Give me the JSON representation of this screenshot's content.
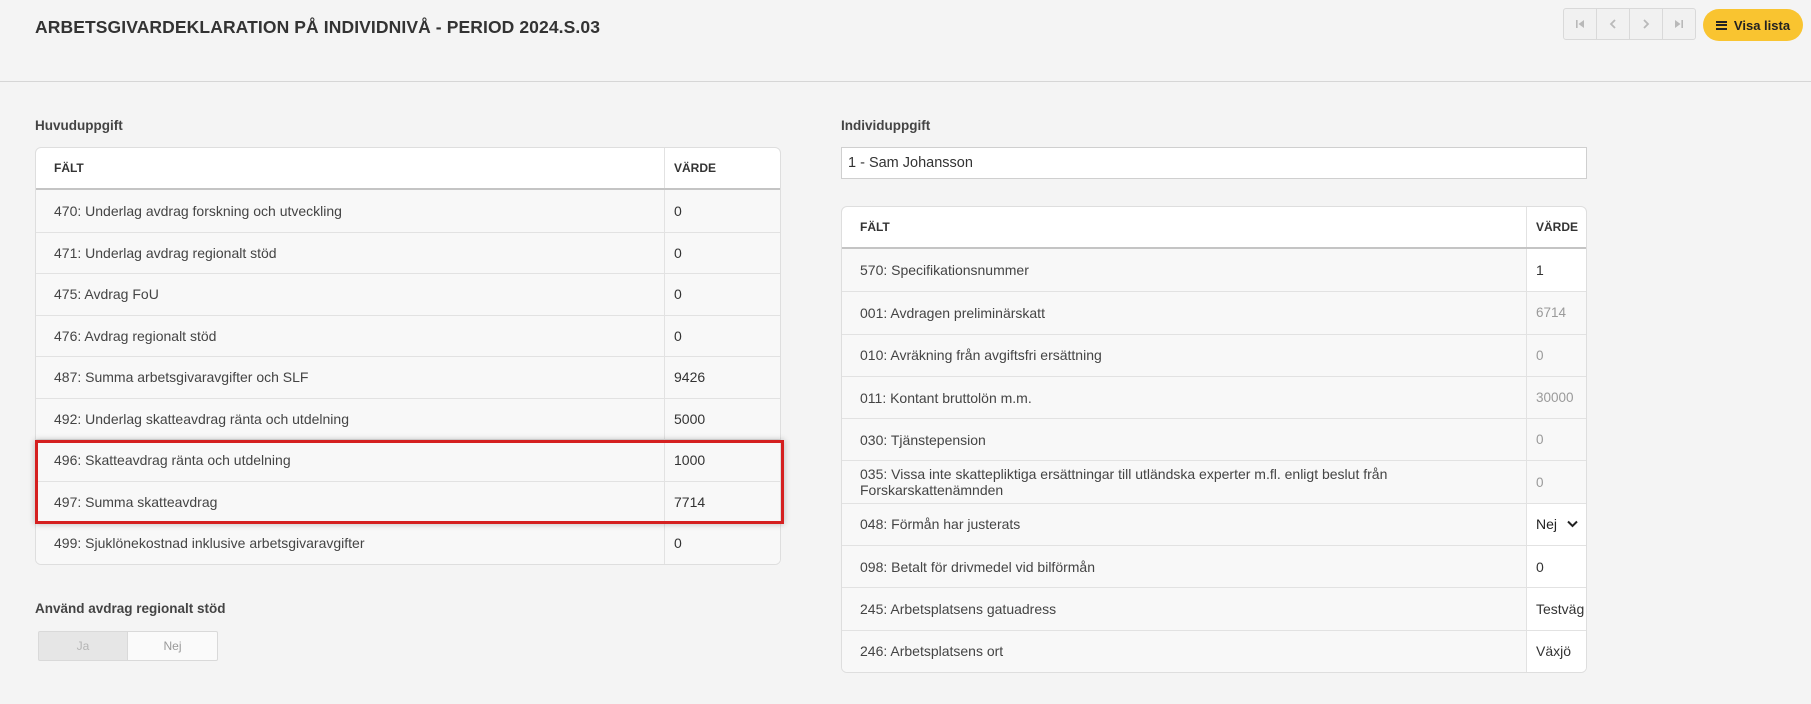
{
  "header": {
    "title": "ARBETSGIVARDEKLARATION PÅ INDIVIDNIVÅ - PERIOD 2024.S.03",
    "nav": {
      "first_icon": "first-page-icon",
      "prev_icon": "chevron-left-icon",
      "next_icon": "chevron-right-icon",
      "last_icon": "last-page-icon"
    },
    "visa_lista_label": "Visa lista",
    "visa_lista_icon": "menu-icon",
    "accent_color": "#f9c430"
  },
  "huvuduppgift": {
    "label": "Huvuduppgift",
    "col_field": "FÄLT",
    "col_value": "VÄRDE",
    "rows": [
      {
        "field": "470: Underlag avdrag forskning och utveckling",
        "value": "0"
      },
      {
        "field": "471: Underlag avdrag regionalt stöd",
        "value": "0"
      },
      {
        "field": "475: Avdrag FoU",
        "value": "0"
      },
      {
        "field": "476: Avdrag regionalt stöd",
        "value": "0"
      },
      {
        "field": "487: Summa arbetsgivaravgifter och SLF",
        "value": "9426"
      },
      {
        "field": "492: Underlag skatteavdrag ränta och utdelning",
        "value": "5000"
      },
      {
        "field": "496: Skatteavdrag ränta och utdelning",
        "value": "1000"
      },
      {
        "field": "497: Summa skatteavdrag",
        "value": "7714"
      },
      {
        "field": "499: Sjuklönekostnad inklusive arbetsgivaravgifter",
        "value": "0"
      }
    ],
    "highlight_color": "#d52020"
  },
  "regionalt_stod": {
    "label": "Använd avdrag regionalt stöd",
    "ja": "Ja",
    "nej": "Nej"
  },
  "individuppgift": {
    "label": "Individuppgift",
    "selected_individual": "1 - Sam Johansson",
    "col_field": "FÄLT",
    "col_value": "VÄRDE",
    "rows": [
      {
        "field": "570: Specifikationsnummer",
        "value": "1"
      },
      {
        "field": "001: Avdragen preliminärskatt",
        "value": "6714"
      },
      {
        "field": "010: Avräkning från avgiftsfri ersättning",
        "value": "0"
      },
      {
        "field": "011: Kontant bruttolön m.m.",
        "value": "30000"
      },
      {
        "field": "030: Tjänstepension",
        "value": "0"
      },
      {
        "field": "035: Vissa inte skattepliktiga ersättningar till utländska experter m.fl. enligt beslut från Forskarskattenämnden",
        "value": "0"
      },
      {
        "field": "048: Förmån har justerats",
        "value": "Nej"
      },
      {
        "field": "098: Betalt för drivmedel vid bilförmån",
        "value": "0"
      },
      {
        "field": "245: Arbetsplatsens gatuadress",
        "value": "Testväg"
      },
      {
        "field": "246: Arbetsplatsens ort",
        "value": "Växjö"
      }
    ]
  }
}
